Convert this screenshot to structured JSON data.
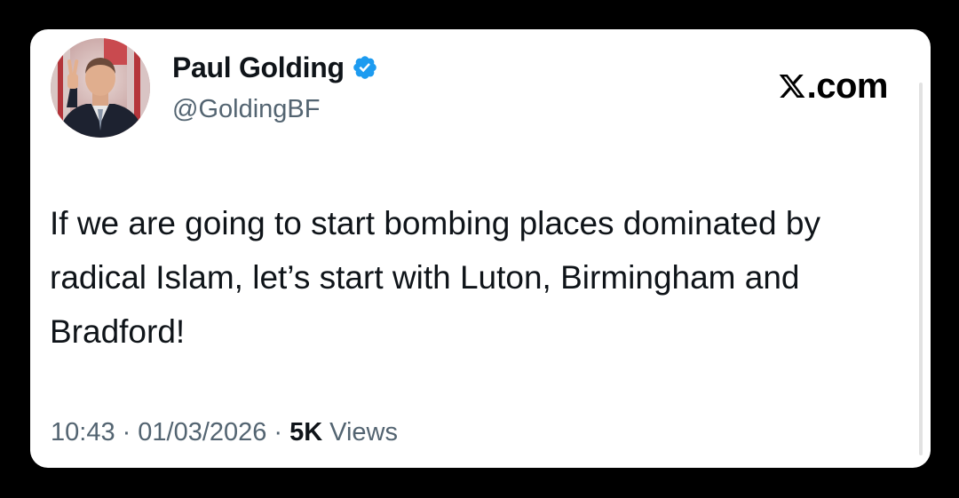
{
  "tweet": {
    "author_name": "Paul Golding",
    "author_handle": "@GoldingBF",
    "verified": true,
    "brand": "X.com",
    "brand_x_glyph": "X",
    "brand_suffix": ".com",
    "text": "If we are going to start bombing places dominated by radical Islam, let’s start with Luton, Birmingham and Bradford!",
    "time": "10:43",
    "separator": "·",
    "date": "01/03/2026",
    "views_count": "5K",
    "views_label": "Views"
  },
  "icons": {
    "verified": "verified-badge-icon",
    "brand": "x-logo-icon",
    "avatar": "profile-avatar"
  },
  "colors": {
    "background": "#000000",
    "card": "#ffffff",
    "text_primary": "#0f1419",
    "text_secondary": "#536471",
    "verified_blue": "#1d9bf0"
  }
}
